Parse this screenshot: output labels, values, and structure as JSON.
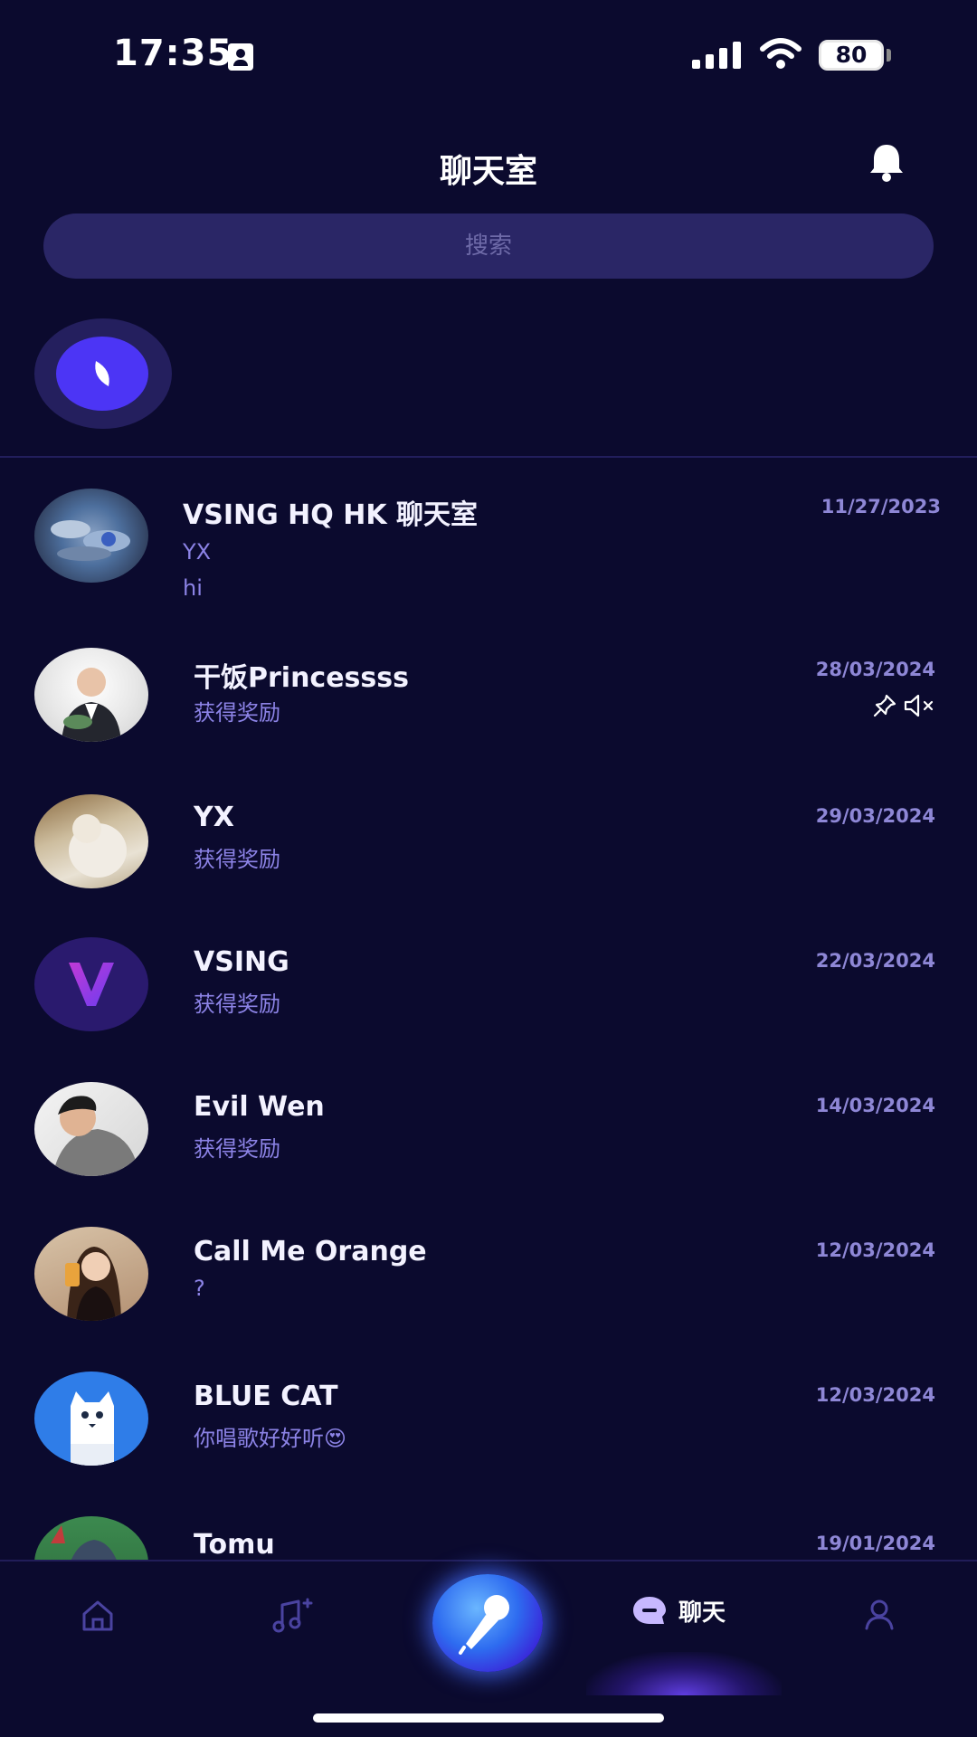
{
  "status_bar": {
    "time": "17:35",
    "battery": "80",
    "battery_level": 0.8
  },
  "header": {
    "title": "聊天室"
  },
  "search": {
    "placeholder": "搜索"
  },
  "chats": [
    {
      "name": "VSING HQ HK 聊天室",
      "sender": "YX",
      "preview": "hi",
      "date": "11/27/2023"
    },
    {
      "name": "干饭Princessss",
      "preview": "获得奖励",
      "date": "28/03/2024",
      "pinned": true,
      "muted": true
    },
    {
      "name": "YX",
      "preview": "获得奖励",
      "date": "29/03/2024"
    },
    {
      "name": "VSING",
      "preview": "获得奖励",
      "date": "22/03/2024"
    },
    {
      "name": "Evil Wen",
      "preview": "获得奖励",
      "date": "14/03/2024"
    },
    {
      "name": "Call Me Orange",
      "preview": "?",
      "date": "12/03/2024"
    },
    {
      "name": "BLUE CAT",
      "preview": "你唱歌好好听😍",
      "date": "12/03/2024"
    },
    {
      "name": "Tomu",
      "preview": "",
      "date": "19/01/2024"
    }
  ],
  "tabbar": {
    "chat_label": "聊天",
    "active_tab": "chat"
  },
  "colors": {
    "background": "#0b0a2e",
    "search_bg": "#2a2666",
    "accent": "#4c35f5",
    "subtext": "#8c83e6"
  }
}
